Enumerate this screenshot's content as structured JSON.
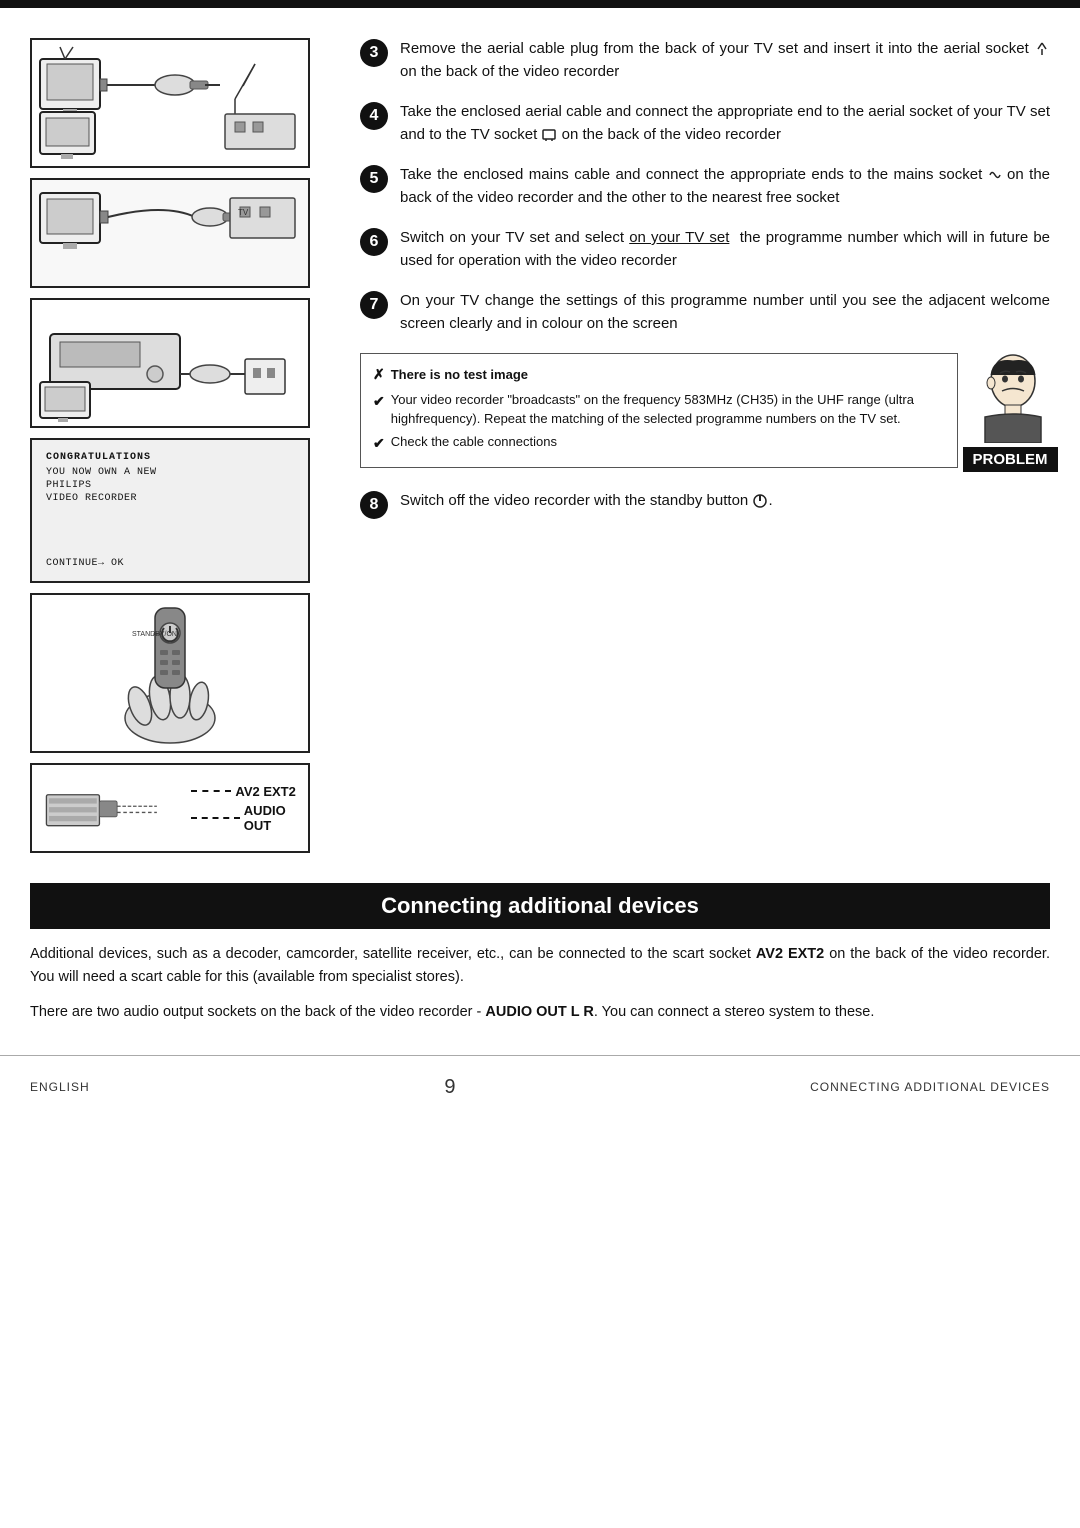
{
  "page": {
    "top_bar": true,
    "footer": {
      "left": "English",
      "center": "9",
      "right": "Connecting additional devices"
    }
  },
  "steps": [
    {
      "number": "3",
      "text": "Remove the aerial cable plug from the back of your TV set and insert it into the aerial socket  on the back of the video recorder",
      "icon": "aerial-socket"
    },
    {
      "number": "4",
      "text": "Take the enclosed aerial cable and connect the appropriate end to the aerial socket of your TV set and to the TV socket  on the back of the video recorder",
      "icon": "tv-socket"
    },
    {
      "number": "5",
      "text": "Take the enclosed mains cable and connect the appropriate ends to the mains socket  on the back of the video recorder and the other to the nearest free socket",
      "icon": "mains-socket"
    },
    {
      "number": "6",
      "text": "Switch on your TV set and select on your TV set  the programme number which will in future be used for operation with the video recorder",
      "underline": "on your TV set"
    },
    {
      "number": "7",
      "text": "On your TV change the settings of this programme number until you see the adjacent welcome screen clearly and in colour on the screen"
    },
    {
      "number": "8",
      "text": "Switch off the video recorder with the standby button"
    }
  ],
  "welcome_screen": {
    "lines": [
      "CONGRATULATIONS",
      "YOU NOW OWN A NEW",
      "PHILIPS",
      "VIDEO RECORDER",
      "",
      "",
      "CONTINUE→ OK"
    ]
  },
  "problem_box": {
    "title": "There is no test image",
    "items": [
      "Your video recorder \"broadcasts\" on the frequency 583MHz (CH35) in the UHF range (ultra highfrequency). Repeat the matching of the selected programme numbers on the TV set.",
      "Check the cable connections"
    ],
    "label": "PROBLEM"
  },
  "section_header": "Connecting additional devices",
  "bottom_paragraphs": [
    "Additional devices, such as a decoder, camcorder, satellite receiver, etc., can be connected to the scart socket AV2 EXT2 on the back of the video recorder. You will need a scart cable for this (available from specialist stores).",
    "There are two audio output sockets on the back of the video recorder - AUDIO OUT L R. You can connect a stereo system to these."
  ],
  "connector_labels": {
    "line1": "AV2 EXT2",
    "line2": "AUDIO OUT"
  },
  "standby_label": "STANDBY/ON",
  "tv_socket_symbol": "📺",
  "aerial_symbol": "T",
  "mains_symbol": "∿"
}
